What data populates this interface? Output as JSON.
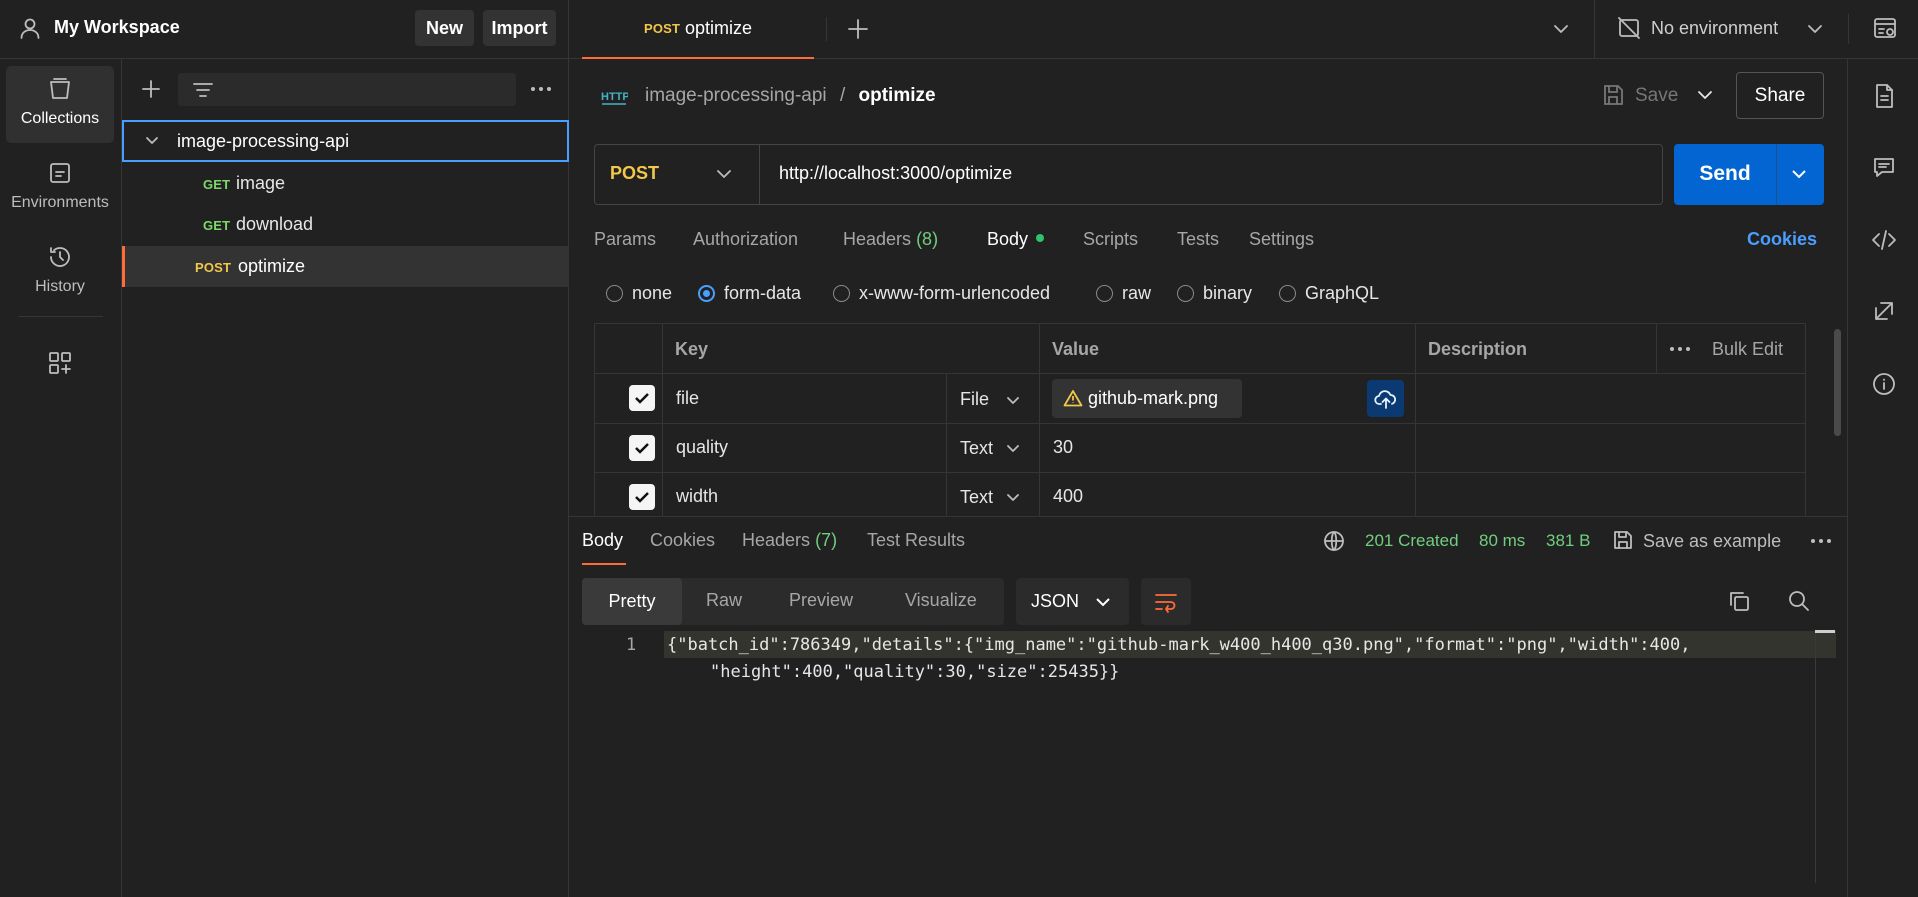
{
  "workspace": {
    "name": "My Workspace",
    "new_label": "New",
    "import_label": "Import"
  },
  "tabs": {
    "active": {
      "method": "POST",
      "name": "optimize"
    }
  },
  "environment": {
    "label": "No environment"
  },
  "left_nav": [
    {
      "label": "Collections"
    },
    {
      "label": "Environments"
    },
    {
      "label": "History"
    }
  ],
  "sidebar": {
    "collection": "image-processing-api",
    "items": [
      {
        "method": "GET",
        "name": "image"
      },
      {
        "method": "GET",
        "name": "download"
      },
      {
        "method": "POST",
        "name": "optimize"
      }
    ]
  },
  "breadcrumb": {
    "collection": "image-processing-api",
    "sep": "/",
    "request": "optimize"
  },
  "actions": {
    "save": "Save",
    "share": "Share",
    "send": "Send"
  },
  "request": {
    "method": "POST",
    "url": "http://localhost:3000/optimize"
  },
  "request_tabs": {
    "params": "Params",
    "authorization": "Authorization",
    "headers": "Headers",
    "headers_count": "(8)",
    "body": "Body",
    "scripts": "Scripts",
    "tests": "Tests",
    "settings": "Settings",
    "cookies": "Cookies"
  },
  "body_types": [
    "none",
    "form-data",
    "x-www-form-urlencoded",
    "raw",
    "binary",
    "GraphQL"
  ],
  "body_type_selected": "form-data",
  "form_table": {
    "headers": {
      "key": "Key",
      "value": "Value",
      "description": "Description",
      "bulk_edit": "Bulk Edit"
    },
    "rows": [
      {
        "key": "file",
        "type": "File",
        "value": "github-mark.png",
        "checked": true
      },
      {
        "key": "quality",
        "type": "Text",
        "value": "30",
        "checked": true
      },
      {
        "key": "width",
        "type": "Text",
        "value": "400",
        "checked": true
      }
    ]
  },
  "response_tabs": {
    "body": "Body",
    "cookies": "Cookies",
    "headers": "Headers",
    "headers_count": "(7)",
    "test_results": "Test Results"
  },
  "response_status": {
    "status": "201 Created",
    "time": "80 ms",
    "size": "381 B",
    "save_example": "Save as example"
  },
  "view_modes": [
    "Pretty",
    "Raw",
    "Preview",
    "Visualize"
  ],
  "view_mode_selected": "Pretty",
  "format": "JSON",
  "response_body": {
    "line_number": "1",
    "line1": "{\"batch_id\":786349,\"details\":{\"img_name\":\"github-mark_w400_h400_q30.png\",\"format\":\"png\",\"width\":400,",
    "line2": "\"height\":400,\"quality\":30,\"size\":25435}}"
  },
  "colors": {
    "accent": "#0265d2",
    "method_post": "#f2c84b",
    "method_get": "#7ed86c",
    "status_ok": "#6fcf7f",
    "link": "#4a9eff",
    "tab_indicator": "#ff6c37"
  }
}
